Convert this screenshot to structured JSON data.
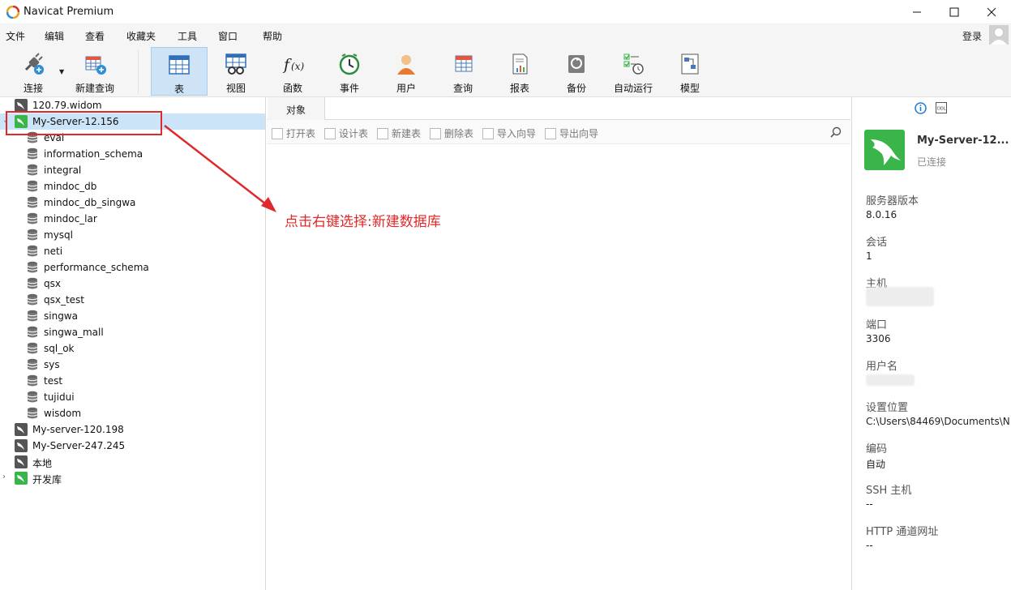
{
  "window": {
    "title": "Navicat Premium",
    "controls": {
      "minimize": "—",
      "maximize": "☐",
      "close": "✕"
    }
  },
  "menu": {
    "items": [
      "文件",
      "编辑",
      "查看",
      "收藏夹",
      "工具",
      "窗口",
      "帮助"
    ],
    "login": "登录"
  },
  "toolbar": {
    "buttons": [
      {
        "label": "连接",
        "icon": "connection-plug-icon"
      },
      {
        "label": "新建查询",
        "icon": "new-query-icon"
      },
      {
        "label": "表",
        "icon": "table-icon",
        "active": true
      },
      {
        "label": "视图",
        "icon": "view-icon"
      },
      {
        "label": "函数",
        "icon": "function-icon"
      },
      {
        "label": "事件",
        "icon": "event-clock-icon"
      },
      {
        "label": "用户",
        "icon": "user-icon"
      },
      {
        "label": "查询",
        "icon": "query-icon"
      },
      {
        "label": "报表",
        "icon": "report-icon"
      },
      {
        "label": "备份",
        "icon": "backup-icon"
      },
      {
        "label": "自动运行",
        "icon": "automation-icon"
      },
      {
        "label": "模型",
        "icon": "model-icon"
      }
    ]
  },
  "tree": {
    "connections_top": [
      {
        "label": "120.79.widom",
        "status": "closed"
      },
      {
        "label": "My-Server-12.156",
        "status": "open",
        "selected": true
      }
    ],
    "databases": [
      "eval",
      "information_schema",
      "integral",
      "mindoc_db",
      "mindoc_db_singwa",
      "mindoc_lar",
      "mysql",
      "neti",
      "performance_schema",
      "qsx",
      "qsx_test",
      "singwa",
      "singwa_mall",
      "sql_ok",
      "sys",
      "test",
      "tujidui",
      "wisdom"
    ],
    "connections_bottom": [
      {
        "label": "My-server-120.198",
        "status": "closed"
      },
      {
        "label": "My-Server-247.245",
        "status": "closed"
      },
      {
        "label": "本地",
        "status": "closed"
      },
      {
        "label": "开发库",
        "status": "open-green",
        "expander": "›"
      }
    ]
  },
  "center": {
    "tab": "对象",
    "actions": [
      "打开表",
      "设计表",
      "新建表",
      "删除表",
      "导入向导",
      "导出向导"
    ]
  },
  "info": {
    "name": "My-Server-12...",
    "status": "已连接",
    "fields": [
      {
        "label": "服务器版本",
        "value": "8.0.16"
      },
      {
        "label": "会话",
        "value": "1"
      },
      {
        "label": "主机",
        "value": ""
      },
      {
        "label": "端口",
        "value": "3306"
      },
      {
        "label": "用户名",
        "value": ""
      },
      {
        "label": "设置位置",
        "value": "C:\\Users\\84469\\Documents\\N"
      },
      {
        "label": "编码",
        "value": "自动"
      },
      {
        "label": "SSH 主机",
        "value": "--"
      },
      {
        "label": "HTTP 通道网址",
        "value": "--"
      }
    ]
  },
  "annotation": {
    "text": "点击右键选择:新建数据库",
    "color": "#e0292a"
  },
  "colors": {
    "mysql_green": "#3ab54a",
    "selection": "#cce4f7",
    "toolbar_active": "#cfe3f7"
  }
}
